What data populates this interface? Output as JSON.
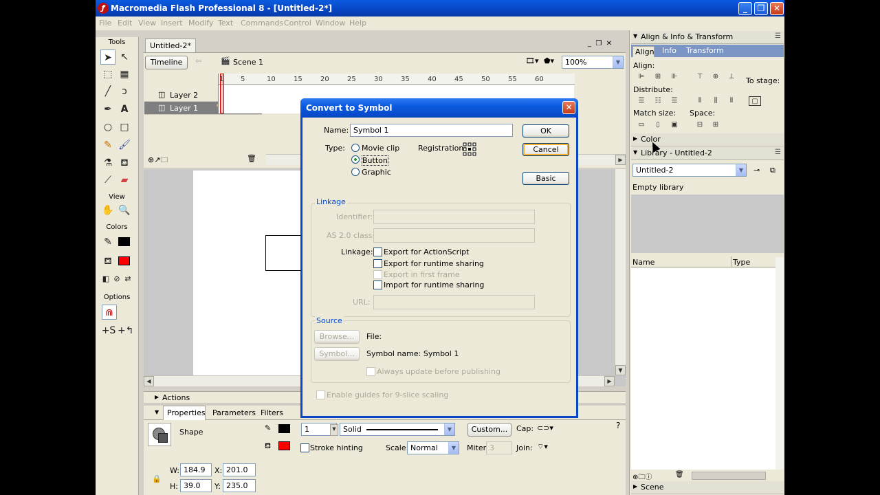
{
  "window": {
    "title": "Macromedia Flash Professional 8 - [Untitled-2*]",
    "min": "_",
    "max": "❐",
    "close": "✕"
  },
  "menu": [
    "File",
    "Edit",
    "View",
    "Insert",
    "Modify",
    "Text",
    "Commands",
    "Control",
    "Window",
    "Help"
  ],
  "tools": {
    "header": "Tools",
    "view_header": "View",
    "colors_header": "Colors",
    "options_header": "Options"
  },
  "document": {
    "tab": "Untitled-2*",
    "timeline_btn": "Timeline",
    "scene": "Scene 1",
    "zoom": "100%"
  },
  "timeline": {
    "layers": [
      "Layer 2",
      "Layer 1"
    ],
    "ruler": [
      "1",
      "5",
      "10",
      "15",
      "20",
      "25",
      "30",
      "35",
      "40",
      "45",
      "50",
      "55",
      "60"
    ]
  },
  "panels": {
    "actions": "Actions",
    "props_tabs": [
      "Properties",
      "Parameters",
      "Filters"
    ],
    "shape_label": "Shape",
    "stroke_width": "1",
    "stroke_style": "Solid",
    "custom_btn": "Custom...",
    "cap_label": "Cap:",
    "stroke_hinting": "Stroke hinting",
    "scale_label": "Scale:",
    "scale_value": "Normal",
    "miter_label": "Miter:",
    "miter_value": "3",
    "join_label": "Join:",
    "w_label": "W:",
    "w": "184.9",
    "x_label": "X:",
    "x": "201.0",
    "h_label": "H:",
    "h": "39.0",
    "y_label": "Y:",
    "y": "235.0"
  },
  "right": {
    "align_header": "Align & Info & Transform",
    "align_tabs": [
      "Align",
      "Info",
      "Transform"
    ],
    "align_label": "Align:",
    "distribute_label": "Distribute:",
    "match_label": "Match size:",
    "space_label": "Space:",
    "to_stage": "To stage:",
    "color_header": "Color",
    "library_header": "Library - Untitled-2",
    "library_select": "Untitled-2",
    "empty": "Empty library",
    "col_name": "Name",
    "col_type": "Type",
    "scene_header": "Scene"
  },
  "dialog": {
    "title": "Convert to Symbol",
    "name_label": "Name:",
    "name_value": "Symbol 1",
    "type_label": "Type:",
    "types": [
      "Movie clip",
      "Button",
      "Graphic"
    ],
    "registration_label": "Registration:",
    "ok": "OK",
    "cancel": "Cancel",
    "basic": "Basic",
    "linkage_group": "Linkage",
    "identifier_label": "Identifier:",
    "as2_label": "AS 2.0 class:",
    "linkage_label": "Linkage:",
    "linkage_opts": [
      "Export for ActionScript",
      "Export for runtime sharing",
      "Export in first frame",
      "Import for runtime sharing"
    ],
    "url_label": "URL:",
    "source_group": "Source",
    "browse_btn": "Browse...",
    "file_label": "File:",
    "symbol_btn": "Symbol...",
    "symbol_name": "Symbol name: Symbol 1",
    "always_update": "Always update before publishing",
    "guides": "Enable guides for 9-slice scaling"
  },
  "colors": {
    "stroke": "#000000",
    "fill": "#ff0000",
    "layer2": "#9933cc",
    "layer1": "#33cc33"
  }
}
